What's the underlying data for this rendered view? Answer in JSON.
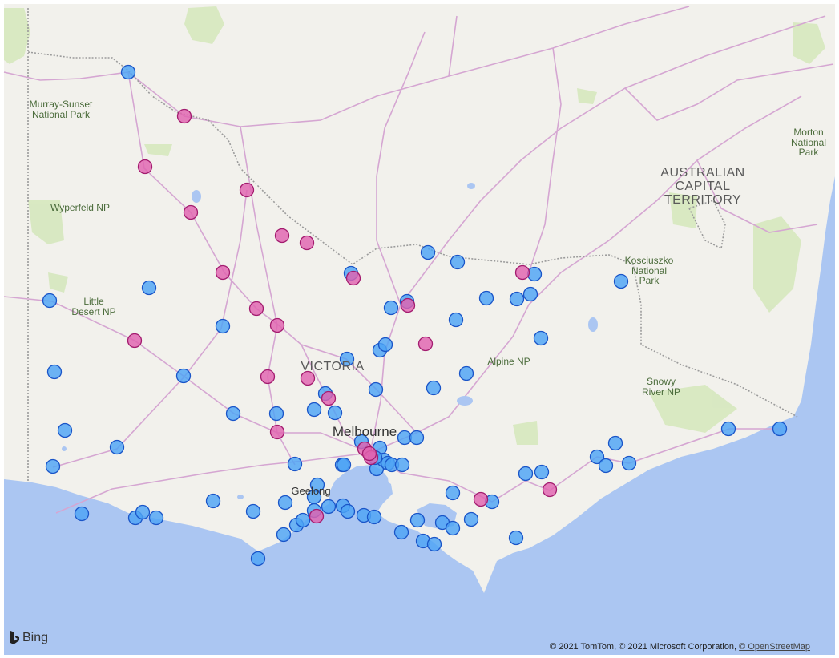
{
  "map": {
    "colors": {
      "land": "#f2f1ec",
      "water": "#abc6f2",
      "park": "#d6e8be",
      "road": "#d5a6d2",
      "border": "#9b9b9b",
      "marker_blue_fill": "#4da3f5",
      "marker_blue_stroke": "#1a55c8",
      "marker_pink_fill": "#e063b0",
      "marker_pink_stroke": "#a31c6f"
    },
    "labels": {
      "murray_sunset": "Murray-Sunset\nNational Park",
      "wyperfeld": "Wyperfeld NP",
      "little_desert": "Little\nDesert NP",
      "victoria": "VICTORIA",
      "alpine": "Alpine NP",
      "snowy_river": "Snowy\nRiver NP",
      "kosciuszko": "Kosciuszko\nNational\nPark",
      "act": "AUSTRALIAN\nCAPITAL\nTERRITORY",
      "morton": "Morton\nNational\nPark",
      "melbourne": "Melbourne",
      "geelong": "Geelong"
    },
    "markers": {
      "blue": 80,
      "pink": 24
    }
  },
  "footer": {
    "brand": "Bing",
    "copyright_text": "© 2021 TomTom, © 2021 Microsoft Corporation, ",
    "osm_link": "© OpenStreetMap"
  }
}
